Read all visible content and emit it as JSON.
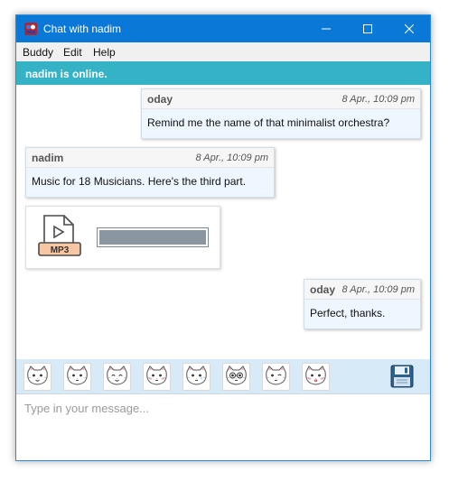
{
  "window": {
    "title": "Chat with nadim",
    "controls": {
      "minimize": "minimize-icon",
      "maximize": "maximize-icon",
      "close": "close-icon"
    }
  },
  "menu": {
    "items": [
      "Buddy",
      "Edit",
      "Help"
    ]
  },
  "status": {
    "text": "nadim is online.",
    "color": "#35b2c5"
  },
  "messages": [
    {
      "sender": "oday",
      "time": "8 Apr., 10:09 pm",
      "text": "Remind me the name of that minimalist orchestra?"
    },
    {
      "sender": "nadim",
      "time": "8 Apr., 10:09 pm",
      "text": "Music for 18 Musicians. Here's the third part."
    },
    {
      "sender": "oday",
      "time": "8 Apr., 10:09 pm",
      "text": "Perfect, thanks."
    }
  ],
  "attachment": {
    "icon": "mp3-file-icon",
    "type_label": "MP3",
    "progress": 1.0
  },
  "emoticons": [
    "smile-cat-icon",
    "neutral-cat-icon",
    "grin-cat-icon",
    "blush-cat-icon",
    "teary-cat-icon",
    "glasses-cat-icon",
    "wink-cat-icon",
    "kiss-cat-icon"
  ],
  "save_icon": "floppy-disk-icon",
  "composer": {
    "placeholder": "Type in your message...",
    "value": ""
  },
  "colors": {
    "titlebar": "#0a78d7",
    "toolbar": "#d7eaf7",
    "bubble": "#eef6ff"
  }
}
